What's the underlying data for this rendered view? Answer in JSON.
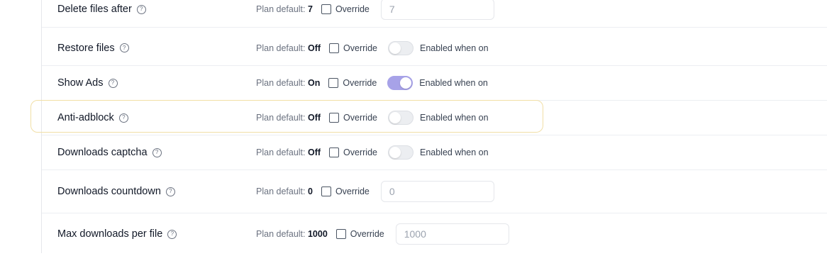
{
  "plan_default_prefix": "Plan default:",
  "override_label": "Override",
  "toggle_label": "Enabled when on",
  "rows": [
    {
      "label": "Delete files after",
      "default": "7",
      "input": "7"
    },
    {
      "label": "Restore files",
      "default": "Off",
      "toggle": "off"
    },
    {
      "label": "Show Ads",
      "default": "On",
      "toggle": "on"
    },
    {
      "label": "Anti-adblock",
      "default": "Off",
      "toggle": "off",
      "highlighted": true
    },
    {
      "label": "Downloads captcha",
      "default": "Off",
      "toggle": "off"
    },
    {
      "label": "Downloads countdown",
      "default": "0",
      "input": "0"
    },
    {
      "label": "Max downloads per file",
      "default": "1000",
      "input": "1000"
    }
  ],
  "colors": {
    "toggle_on": "#a7a2e8",
    "highlight_border": "#f1dfa6"
  }
}
